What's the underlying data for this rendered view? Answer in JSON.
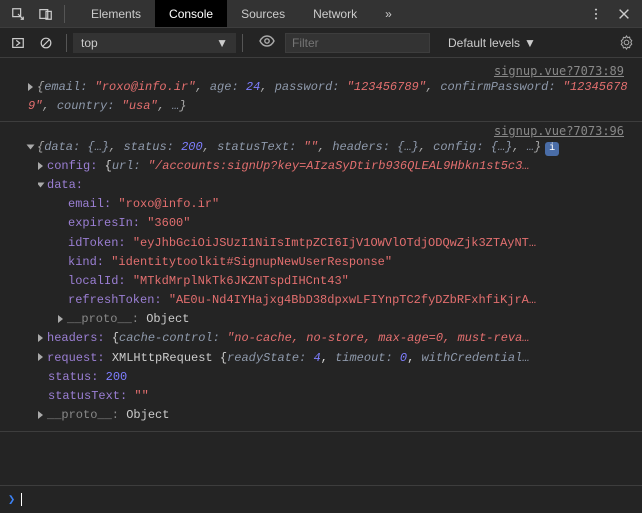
{
  "tabs": {
    "elements": "Elements",
    "console": "Console",
    "sources": "Sources",
    "network": "Network"
  },
  "subtoolbar": {
    "context": "top",
    "filter_placeholder": "Filter",
    "levels": "Default levels"
  },
  "log1": {
    "source": "signup.vue?7073:89",
    "summary": {
      "email_k": "email:",
      "email_v": "\"roxo@info.ir\"",
      "age_k": "age:",
      "age_v": "24",
      "password_k": "password:",
      "password_v": "\"123456789\"",
      "confirm_k": "confirmPassword:",
      "confirm_v": "\"123456789\"",
      "country_k": "country:",
      "country_v": "\"usa\"",
      "rest": "…"
    }
  },
  "log2": {
    "source": "signup.vue?7073:96",
    "summary": {
      "data_k": "data:",
      "data_v": "{…}",
      "status_k": "status:",
      "status_v": "200",
      "statusText_k": "statusText:",
      "statusText_v": "\"\"",
      "headers_k": "headers:",
      "headers_v": "{…}",
      "config_k": "config:",
      "config_v": "{…}",
      "rest": "…"
    },
    "config": {
      "key": "config:",
      "url_k": "url:",
      "url_v": "\"/accounts:signUp?key=AIzaSyDtirb936QLEAL9Hbkn1st5c3…"
    },
    "data": {
      "key": "data:",
      "email_k": "email:",
      "email_v": "\"roxo@info.ir\"",
      "expiresIn_k": "expiresIn:",
      "expiresIn_v": "\"3600\"",
      "idToken_k": "idToken:",
      "idToken_v": "\"eyJhbGciOiJSUzI1NiIsImtpZCI6IjV1OWVlOTdjODQwZjk3ZTAyNT…",
      "kind_k": "kind:",
      "kind_v": "\"identitytoolkit#SignupNewUserResponse\"",
      "localId_k": "localId:",
      "localId_v": "\"MTkdMrplNkTk6JKZNTspdIHCnt43\"",
      "refreshToken_k": "refreshToken:",
      "refreshToken_v": "\"AE0u-Nd4IYHajxg4BbD38dpxwLFIYnpTC2fyDZbRFxhfiKjrA…",
      "proto_k": "__proto__:",
      "proto_v": "Object"
    },
    "headers": {
      "key": "headers:",
      "cache_k": "cache-control:",
      "cache_v": "\"no-cache, no-store, max-age=0, must-reva…"
    },
    "request": {
      "key": "request:",
      "type": "XMLHttpRequest",
      "ready_k": "readyState:",
      "ready_v": "4",
      "timeout_k": "timeout:",
      "timeout_v": "0",
      "withc": "withCredential…"
    },
    "status": {
      "k": "status:",
      "v": "200"
    },
    "statusText": {
      "k": "statusText:",
      "v": "\"\""
    },
    "proto": {
      "k": "__proto__:",
      "v": "Object"
    }
  }
}
